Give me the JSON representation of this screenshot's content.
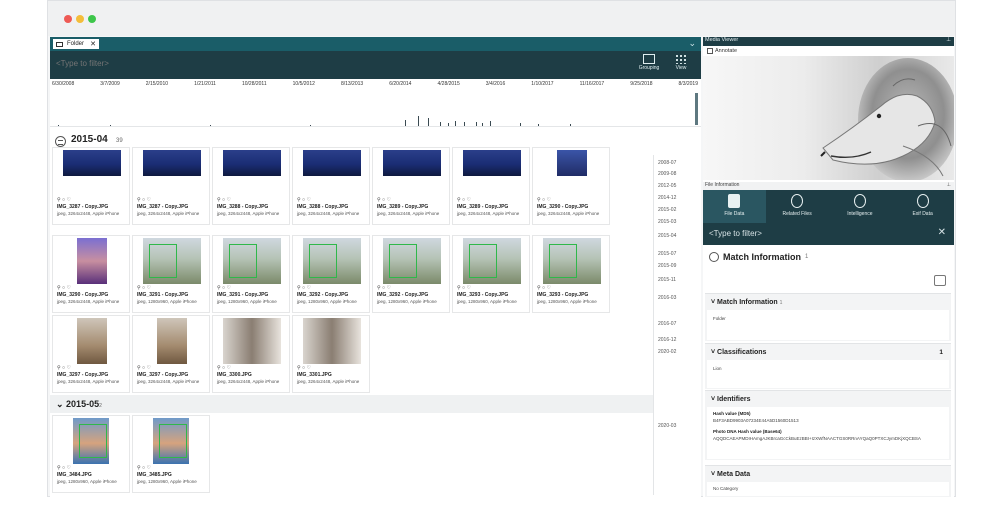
{
  "window": {
    "traffic_lights": [
      "close",
      "minimize",
      "maximize"
    ]
  },
  "left": {
    "tab_label": "Folder",
    "filter_placeholder": "<Type to filter>",
    "toolbar": {
      "grouping": "Grouping",
      "view": "View"
    },
    "timeline_dates": [
      "6/30/2008",
      "3/7/2009",
      "2/15/2010",
      "1/21/2011",
      "10/28/2011",
      "10/5/2012",
      "8/13/2013",
      "6/20/2014",
      "4/28/2015",
      "3/4/2016",
      "1/10/2017",
      "11/16/2017",
      "9/25/2018",
      "8/3/2019"
    ],
    "group1": {
      "title": "2015-04",
      "count": "39"
    },
    "group2": {
      "title": "2015-05",
      "count": "2"
    },
    "cards": [
      {
        "name": "IMG_3287 - Copy.JPG",
        "info": "jpeg, 3264x2448, Apple iPhone",
        "kind": "concert"
      },
      {
        "name": "IMG_3287 - Copy.JPG",
        "info": "jpeg, 3264x2448, Apple iPhone",
        "kind": "concert"
      },
      {
        "name": "IMG_3288 - Copy.JPG",
        "info": "jpeg, 3264x2448, Apple iPhone",
        "kind": "concert"
      },
      {
        "name": "IMG_3288 - Copy.JPG",
        "info": "jpeg, 3264x2448, Apple iPhone",
        "kind": "concert"
      },
      {
        "name": "IMG_3289 - Copy.JPG",
        "info": "jpeg, 3264x2448, Apple iPhone",
        "kind": "concert"
      },
      {
        "name": "IMG_3289 - Copy.JPG",
        "info": "jpeg, 3264x2448, Apple iPhone",
        "kind": "concert"
      },
      {
        "name": "IMG_3290 - Copy.JPG",
        "info": "jpeg, 3264x2448, Apple iPhone",
        "kind": "concert-portrait"
      },
      {
        "name": "IMG_3290 - Copy.JPG",
        "info": "jpeg, 3264x2448, Apple iPhone",
        "kind": "selfie-portrait"
      },
      {
        "name": "IMG_3291 - Copy.JPG",
        "info": "jpeg, 1280x960, Apple iPhone",
        "kind": "face"
      },
      {
        "name": "IMG_3291 - Copy.JPG",
        "info": "jpeg, 1280x960, Apple iPhone",
        "kind": "face"
      },
      {
        "name": "IMG_3292 - Copy.JPG",
        "info": "jpeg, 1280x960, Apple iPhone",
        "kind": "face"
      },
      {
        "name": "IMG_3292 - Copy.JPG",
        "info": "jpeg, 1280x960, Apple iPhone",
        "kind": "face"
      },
      {
        "name": "IMG_3293 - Copy.JPG",
        "info": "jpeg, 1280x960, Apple iPhone",
        "kind": "face"
      },
      {
        "name": "IMG_3293 - Copy.JPG",
        "info": "jpeg, 1280x960, Apple iPhone",
        "kind": "face"
      },
      {
        "name": "IMG_3297 - Copy.JPG",
        "info": "jpeg, 3264x2448, Apple iPhone",
        "kind": "room-portrait"
      },
      {
        "name": "IMG_3297 - Copy.JPG",
        "info": "jpeg, 3264x2448, Apple iPhone",
        "kind": "room-portrait"
      },
      {
        "name": "IMG_3300.JPG",
        "info": "jpeg, 3264x2448, Apple iPhone",
        "kind": "room"
      },
      {
        "name": "IMG_3301.JPG",
        "info": "jpeg, 3264x2448, Apple iPhone",
        "kind": "room"
      }
    ],
    "cards2": [
      {
        "name": "IMG_3484.JPG",
        "info": "jpeg, 1280x960, Apple iPhone",
        "kind": "man-portrait"
      },
      {
        "name": "IMG_3485.JPG",
        "info": "jpeg, 1280x960, Apple iPhone",
        "kind": "man-portrait"
      }
    ],
    "side_dates": [
      "2008-07",
      "2009-08",
      "2012-05",
      "2014-12",
      "2015-02",
      "2015-03",
      "2015-04",
      "2015-07",
      "2015-09",
      "2015-11",
      "2016-03",
      "2016-07",
      "2016-12",
      "2020-02",
      "2020-03"
    ]
  },
  "right": {
    "media_viewer_label": "Media Viewer",
    "annotate_label": "Annotate",
    "file_info_label": "File Information",
    "tabs": [
      "File Data",
      "Related Files",
      "Intelligence",
      "Exif Data"
    ],
    "filter_placeholder": "<Type to filter>",
    "match_title": "Match Information",
    "match_count": "1",
    "sections": {
      "match": {
        "title": "Match Information",
        "count": "1",
        "lines": [
          "Folder"
        ]
      },
      "classifications": {
        "title": "Classifications",
        "count": "1",
        "lines": [
          "Lion"
        ]
      },
      "identifiers": {
        "title": "Identifiers",
        "lines": [
          "Hash value (MD5)",
          "B4F3ABD9903A07234E44A5D1560D1513",
          "Photo DNA Hash value (Base64)",
          "AQQDCAEAPMDIHAmgAJKBrcaGcCkBuEzBBI+IzXWfNAACTGS0RRnAYQaQ0PTXCJymDKjXQCBSA"
        ]
      },
      "meta": {
        "title": "Meta Data",
        "lines": [
          "No Category"
        ]
      }
    }
  },
  "colors": {
    "teal_dark": "#1e3d45",
    "teal_tab": "#1a5d68",
    "face_box": "#2fb84a"
  }
}
